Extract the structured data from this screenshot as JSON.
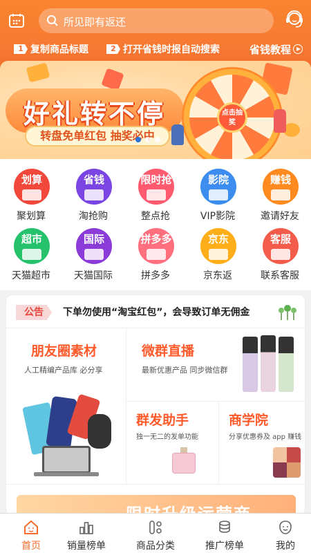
{
  "header": {
    "search_placeholder": "所见即有返还",
    "steps": [
      {
        "num": "1",
        "label": "复制商品标题"
      },
      {
        "num": "2",
        "label": "打开省钱时报自动搜索"
      }
    ],
    "tutorial": "省钱教程"
  },
  "banner": {
    "title": "好礼转不停",
    "subtitle": "转盘免单红包 抽奖必中",
    "wheel_center": "点击抽奖",
    "slide_count": 3,
    "active_slide": 1
  },
  "grid": [
    {
      "badge": "划算",
      "label": "聚划算",
      "color": "#f2483b"
    },
    {
      "badge": "省钱",
      "label": "淘抢购",
      "color": "#7b45e3"
    },
    {
      "badge": "限时抢",
      "label": "整点抢",
      "color": "#ff5a6e"
    },
    {
      "badge": "影院",
      "label": "VIP影院",
      "color": "#3d8cf0"
    },
    {
      "badge": "赚钱",
      "label": "邀请好友",
      "color": "#ff8a1f"
    },
    {
      "badge": "超市",
      "label": "天猫超市",
      "color": "#25c26b"
    },
    {
      "badge": "国际",
      "label": "天猫国际",
      "color": "#8a3bd8"
    },
    {
      "badge": "拼多多",
      "label": "拼多多",
      "color": "#ff6f7d"
    },
    {
      "badge": "京东",
      "label": "京东返",
      "color": "#ffae1a"
    },
    {
      "badge": "客服",
      "label": "联系客服",
      "color": "#f35b4a"
    }
  ],
  "notice": {
    "tag": "公告",
    "text": "下单勿使用“淘宝红包”，会导致订单无佣金"
  },
  "modules": {
    "moments": {
      "title": "朋友圈素材",
      "sub": "人工精编产品库 必分享"
    },
    "live": {
      "title": "微群直播",
      "sub": "最新优惠产品 同步微信群"
    },
    "mass": {
      "title": "群发助手",
      "sub": "独一无二的发单功能"
    },
    "academy": {
      "title": "商学院",
      "sub": "分享优惠券及 app 赚钱"
    }
  },
  "promo": {
    "text": "限时升级运营商"
  },
  "tabs": [
    {
      "label": "首页",
      "icon": "home-icon",
      "active": true
    },
    {
      "label": "销量榜单",
      "icon": "ranking-icon",
      "active": false
    },
    {
      "label": "商品分类",
      "icon": "category-icon",
      "active": false
    },
    {
      "label": "推广榜单",
      "icon": "coins-icon",
      "active": false
    },
    {
      "label": "我的",
      "icon": "profile-icon",
      "active": false
    }
  ],
  "colors": {
    "brand_orange": "#f36e2f",
    "title_red": "#ff5a2b"
  }
}
